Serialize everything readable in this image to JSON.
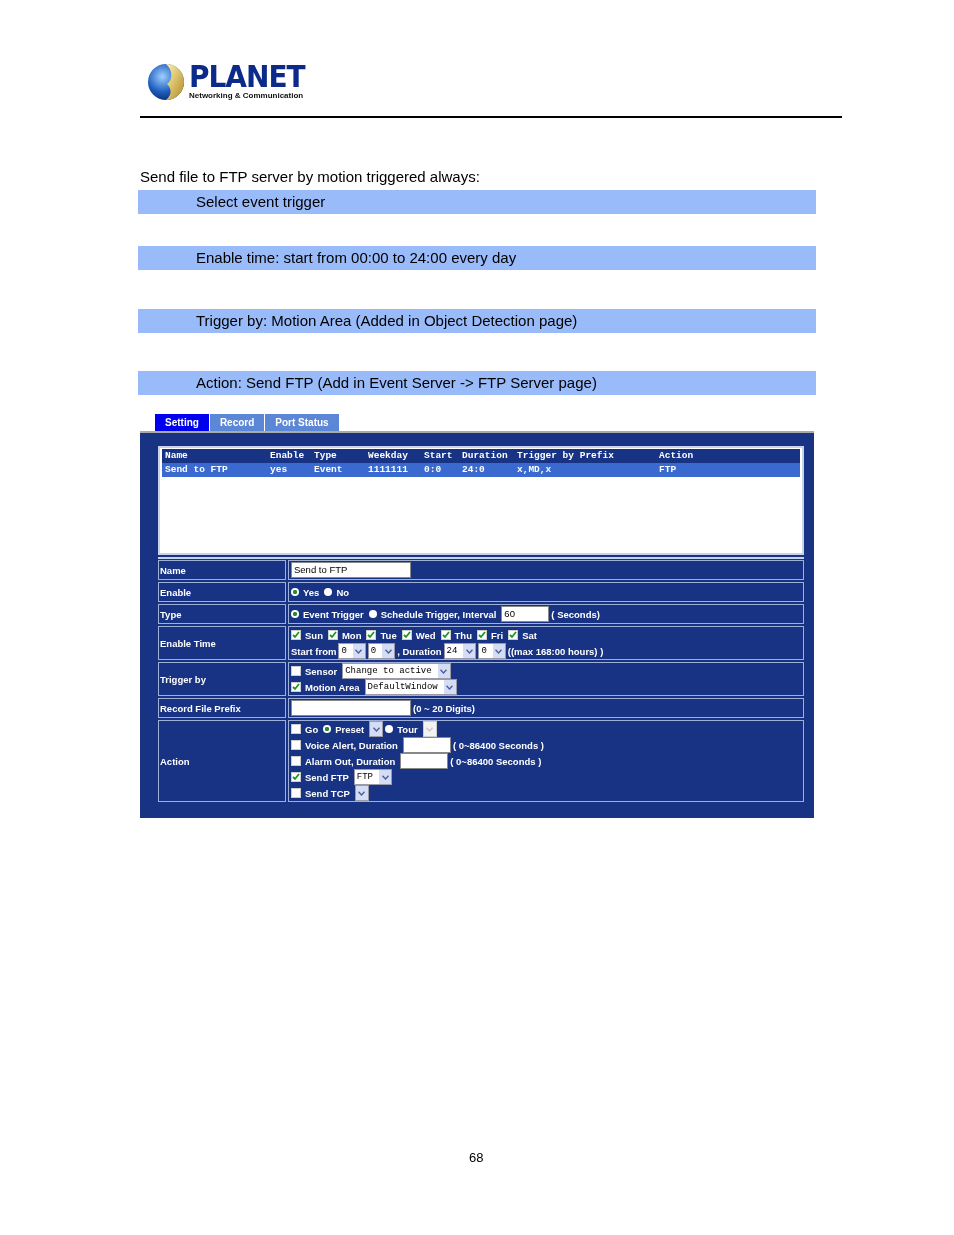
{
  "logo": {
    "name": "PLANET",
    "tagline": "Networking & Communication"
  },
  "intro": "Send file to FTP server by motion triggered always:",
  "steps": [
    "Select event trigger",
    "Enable time: start from 00:00 to 24:00 every day",
    "Trigger by: Motion Area (Added in Object Detection page)",
    "Action: Send FTP (Add in Event Server -> FTP Server page)"
  ],
  "app": {
    "tabs": [
      {
        "label": "Setting",
        "selected": true
      },
      {
        "label": "Record",
        "selected": false
      },
      {
        "label": "Port Status",
        "selected": false
      }
    ],
    "event_list": {
      "columns": [
        "Name",
        "Enable",
        "Type",
        "Weekday",
        "Start",
        "Duration",
        "Trigger by Prefix",
        "Action"
      ],
      "rows": [
        {
          "selected": true,
          "cells": [
            "Send to FTP",
            "yes",
            "Event",
            "1111111",
            "0:0",
            "24:0",
            "x,MD,x",
            "FTP"
          ]
        }
      ]
    },
    "form": [
      {
        "label": "Name",
        "lines": [
          [
            {
              "kind": "input",
              "value": "Send to FTP"
            }
          ]
        ]
      },
      {
        "label": "Enable",
        "lines": [
          [
            {
              "kind": "radio",
              "selected": true,
              "label": "Yes"
            },
            {
              "kind": "radio",
              "selected": false,
              "label": "No"
            }
          ]
        ]
      },
      {
        "label": "Type",
        "lines": [
          [
            {
              "kind": "radio",
              "selected": true,
              "label": "Event Trigger"
            },
            {
              "kind": "radio",
              "selected": false,
              "label": "Schedule Trigger, Interval"
            },
            {
              "kind": "short_input",
              "value": "60"
            },
            {
              "kind": "text",
              "text": "( Seconds)"
            }
          ]
        ]
      },
      {
        "label": "Enable Time",
        "lines": [
          [
            {
              "kind": "checkbox",
              "checked": true,
              "label": "Sun"
            },
            {
              "kind": "checkbox",
              "checked": true,
              "label": "Mon"
            },
            {
              "kind": "checkbox",
              "checked": true,
              "label": "Tue"
            },
            {
              "kind": "checkbox",
              "checked": true,
              "label": "Wed"
            },
            {
              "kind": "checkbox",
              "checked": true,
              "label": "Thu"
            },
            {
              "kind": "checkbox",
              "checked": true,
              "label": "Fri"
            },
            {
              "kind": "checkbox",
              "checked": true,
              "label": "Sat"
            }
          ],
          [
            {
              "kind": "text",
              "text": "Start from"
            },
            {
              "kind": "select",
              "value": "0"
            },
            {
              "kind": "select",
              "value": "0"
            },
            {
              "kind": "text",
              "text": ", Duration"
            },
            {
              "kind": "select",
              "value": "24"
            },
            {
              "kind": "select",
              "value": "0"
            },
            {
              "kind": "text",
              "text": "((max 168:00 hours) )"
            }
          ]
        ]
      },
      {
        "label": "Trigger by",
        "lines": [
          [
            {
              "kind": "checkbox",
              "checked": false,
              "label": "Sensor"
            },
            {
              "kind": "select",
              "value": "Change to active"
            }
          ],
          [
            {
              "kind": "checkbox",
              "checked": true,
              "label": "Motion Area"
            },
            {
              "kind": "select",
              "value": "DefaultWindow"
            }
          ]
        ]
      },
      {
        "label": "Record File Prefix",
        "lines": [
          [
            {
              "kind": "input"
            },
            {
              "kind": "text",
              "text": "(0 ~ 20 Digits)"
            }
          ]
        ]
      },
      {
        "label": "Action",
        "lines": [
          [
            {
              "kind": "checkbox",
              "checked": false,
              "label": "Go"
            },
            {
              "kind": "radio",
              "selected": true,
              "label": "Preset"
            },
            {
              "kind": "select",
              "disabled": false
            },
            {
              "kind": "radio",
              "selected": false,
              "label": "Tour"
            },
            {
              "kind": "select",
              "disabled": true
            }
          ],
          [
            {
              "kind": "checkbox",
              "checked": false,
              "label": "Voice Alert, Duration"
            },
            {
              "kind": "short_input"
            },
            {
              "kind": "text",
              "text": "( 0~86400 Seconds )"
            }
          ],
          [
            {
              "kind": "checkbox",
              "checked": false,
              "label": "Alarm Out, Duration"
            },
            {
              "kind": "short_input"
            },
            {
              "kind": "text",
              "text": "( 0~86400 Seconds )"
            }
          ],
          [
            {
              "kind": "checkbox",
              "checked": true,
              "label": "Send FTP"
            },
            {
              "kind": "select",
              "value": "FTP"
            }
          ],
          [
            {
              "kind": "checkbox",
              "checked": false,
              "label": "Send TCP"
            },
            {
              "kind": "select",
              "disabled": false
            }
          ]
        ]
      }
    ]
  },
  "page_number": "68"
}
